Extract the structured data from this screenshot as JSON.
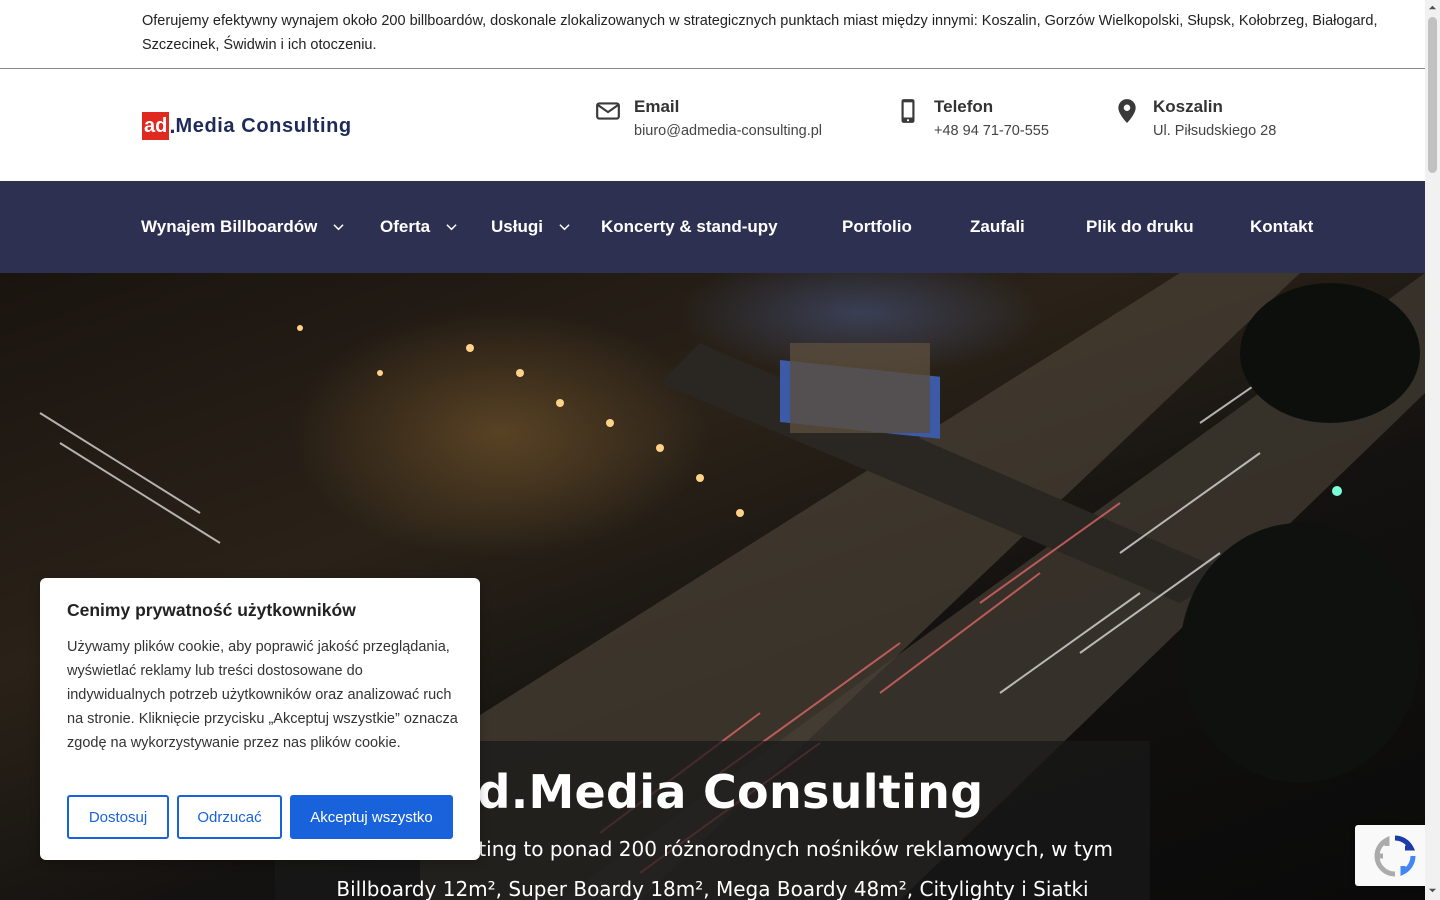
{
  "topbar": {
    "text": "Oferujemy efektywny wynajem około 200 billboardów, doskonale zlokalizowanych w strategicznych punktach miast między innymi: Koszalin, Gorzów Wielkopolski, Słupsk, Kołobrzeg, Białogard, Szczecinek, Świdwin i ich otoczeniu."
  },
  "logo": {
    "ad": "ad",
    "dot": ".",
    "rest": "Media Consulting"
  },
  "contacts": {
    "email": {
      "title": "Email",
      "value": "biuro@admedia-consulting.pl",
      "icon": "envelope-icon"
    },
    "phone": {
      "title": "Telefon",
      "value": "+48 94 71-70-555",
      "icon": "phone-icon"
    },
    "location": {
      "title": "Koszalin",
      "value": "Ul. Piłsudskiego 28",
      "icon": "map-pin-icon"
    }
  },
  "nav": {
    "items": [
      {
        "label": "Wynajem Billboardów",
        "dropdown": true
      },
      {
        "label": "Oferta",
        "dropdown": true
      },
      {
        "label": "Usługi",
        "dropdown": true
      },
      {
        "label": "Koncerty & stand-upy",
        "dropdown": false
      },
      {
        "label": "Portfolio",
        "dropdown": false
      },
      {
        "label": "Zaufali",
        "dropdown": false
      },
      {
        "label": "Plik do druku",
        "dropdown": false
      },
      {
        "label": "Kontakt",
        "dropdown": false
      }
    ]
  },
  "hero": {
    "title": "Ad.Media Consulting",
    "subtitle_line1": "Ad.Media Consulting to ponad 200 różnorodnych nośników reklamowych, w tym",
    "subtitle_line2": "Billboardy 12m², Super Boardy 18m², Mega Boardy 48m², Citylighty i Siatki"
  },
  "cookie": {
    "title": "Cenimy prywatność użytkowników",
    "body": "Używamy plików cookie, aby poprawić jakość przeglądania, wyświetlać reklamy lub treści dostosowane do indywidualnych potrzeb użytkowników oraz analizować ruch na stronie. Kliknięcie przycisku „Akceptuj wszystkie” oznacza zgodę na wykorzystywanie przez nas plików cookie.",
    "btn_customize": "Dostosuj",
    "btn_reject": "Odrzucać",
    "btn_accept": "Akceptuj wszystko"
  },
  "colors": {
    "nav_bg": "#2e3052",
    "accent_blue": "#1863dc",
    "logo_red": "#e02a1f",
    "logo_navy": "#1e2a5a"
  }
}
